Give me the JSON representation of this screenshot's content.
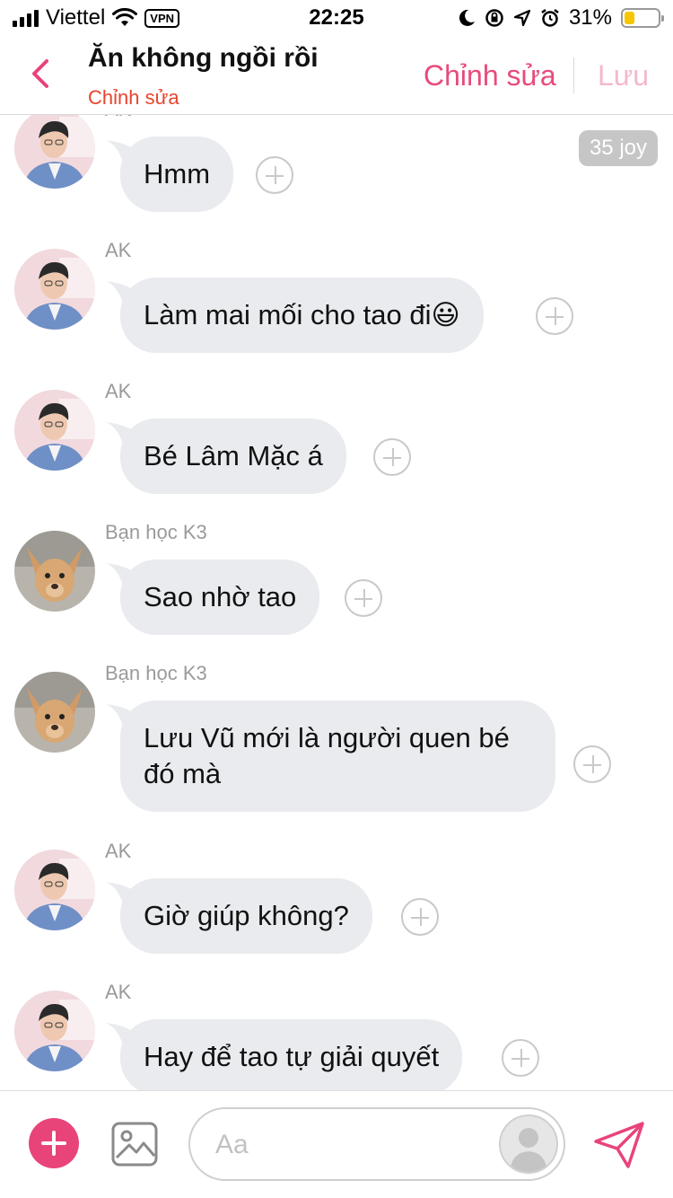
{
  "status_bar": {
    "carrier": "Viettel",
    "vpn": "VPN",
    "time": "22:25",
    "battery_percent": "31%",
    "battery_level": 0.31
  },
  "header": {
    "title": "Ăn không ngồi rồi",
    "subtitle": "Chỉnh sửa",
    "edit_label": "Chỉnh sửa",
    "save_label": "Lưu"
  },
  "joy_badge": "35 joy",
  "messages": [
    {
      "sender": "AK",
      "text": "Hmm",
      "avatar": "ak"
    },
    {
      "sender": "AK",
      "text": "Làm mai mối cho tao đi",
      "emoji": "😃",
      "avatar": "ak"
    },
    {
      "sender": "AK",
      "text": "Bé Lâm Mặc á",
      "avatar": "ak"
    },
    {
      "sender": "Bạn học K3",
      "text": "Sao nhờ tao",
      "avatar": "dog"
    },
    {
      "sender": "Bạn học K3",
      "text_line1": "Lưu Vũ mới là người quen bé",
      "text_line2": "đó mà",
      "avatar": "dog"
    },
    {
      "sender": "AK",
      "text": "Giờ giúp không?",
      "avatar": "ak"
    },
    {
      "sender": "AK",
      "text": "Hay để tao tự giải quyết",
      "avatar": "ak"
    }
  ],
  "composer": {
    "placeholder": "Aa"
  },
  "colors": {
    "accent": "#e8447a",
    "subtitle": "#e8442e",
    "bubble": "#e9ebee",
    "save_disabled": "#f3b9cb"
  },
  "icons": [
    "back-chevron-icon",
    "wifi-icon",
    "signal-icon",
    "moon-icon",
    "rotation-lock-icon",
    "location-icon",
    "alarm-icon",
    "battery-icon",
    "add-icon",
    "image-icon",
    "send-icon"
  ]
}
